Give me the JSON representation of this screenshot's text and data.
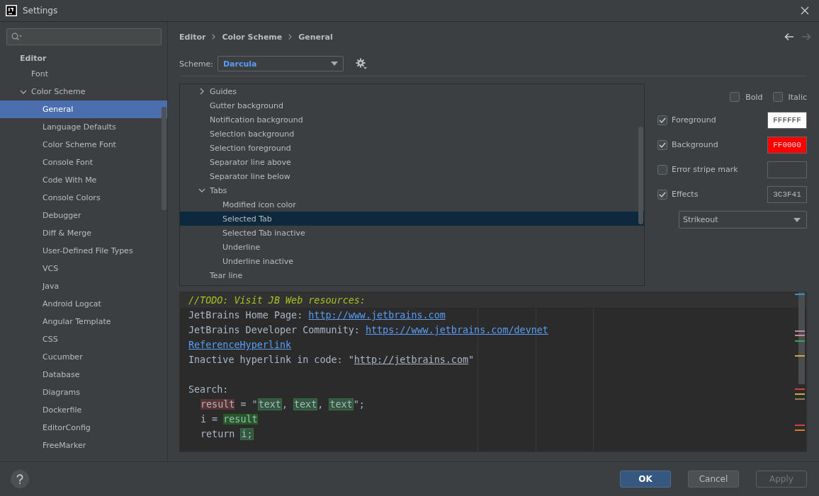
{
  "window": {
    "title": "Settings"
  },
  "sidebar": {
    "items": [
      {
        "label": "Editor",
        "kind": "header",
        "children": [
          {
            "label": "Font",
            "selected": false
          },
          {
            "label": "Color Scheme",
            "selected": false,
            "expanded": true,
            "children": [
              {
                "label": "General",
                "selected": true
              },
              {
                "label": "Language Defaults",
                "selected": false
              },
              {
                "label": "Color Scheme Font",
                "selected": false
              },
              {
                "label": "Console Font",
                "selected": false
              },
              {
                "label": "Code With Me",
                "selected": false
              },
              {
                "label": "Console Colors",
                "selected": false
              },
              {
                "label": "Debugger",
                "selected": false
              },
              {
                "label": "Diff & Merge",
                "selected": false
              },
              {
                "label": "User-Defined File Types",
                "selected": false
              },
              {
                "label": "VCS",
                "selected": false
              },
              {
                "label": "Java",
                "selected": false
              },
              {
                "label": "Android Logcat",
                "selected": false
              },
              {
                "label": "Angular Template",
                "selected": false
              },
              {
                "label": "CSS",
                "selected": false
              },
              {
                "label": "Cucumber",
                "selected": false
              },
              {
                "label": "Database",
                "selected": false
              },
              {
                "label": "Diagrams",
                "selected": false
              },
              {
                "label": "Dockerfile",
                "selected": false
              },
              {
                "label": "EditorConfig",
                "selected": false
              },
              {
                "label": "FreeMarker",
                "selected": false
              }
            ]
          }
        ]
      }
    ]
  },
  "breadcrumb": [
    "Editor",
    "Color Scheme",
    "General"
  ],
  "navigation": {
    "back_disabled": false,
    "forward_disabled": true
  },
  "scheme": {
    "label": "Scheme:",
    "value": "Darcula"
  },
  "elements": [
    {
      "label": "Guides",
      "selected": false,
      "expanded": false
    },
    {
      "label": "Gutter background",
      "selected": false
    },
    {
      "label": "Notification background",
      "selected": false
    },
    {
      "label": "Selection background",
      "selected": false
    },
    {
      "label": "Selection foreground",
      "selected": false
    },
    {
      "label": "Separator line above",
      "selected": false
    },
    {
      "label": "Separator line below",
      "selected": false
    },
    {
      "label": "Tabs",
      "selected": false,
      "expanded": true,
      "children": [
        {
          "label": "Modified icon color",
          "selected": false
        },
        {
          "label": "Selected Tab",
          "selected": true
        },
        {
          "label": "Selected Tab inactive",
          "selected": false
        },
        {
          "label": "Underline",
          "selected": false
        },
        {
          "label": "Underline inactive",
          "selected": false
        }
      ]
    },
    {
      "label": "Tear line",
      "selected": false
    }
  ],
  "font_style": [
    {
      "label": "Bold",
      "checked": false
    },
    {
      "label": "Italic",
      "checked": false
    }
  ],
  "attributes": [
    {
      "label": "Foreground",
      "checked": true,
      "value": "FFFFFF",
      "color": "#ffffff"
    },
    {
      "label": "Background",
      "checked": true,
      "value": "FF0000",
      "color": "#ff0000"
    },
    {
      "label": "Error stripe mark",
      "checked": false
    },
    {
      "label": "Effects",
      "checked": true,
      "value": "3C3F41",
      "color": "#3c3f41"
    }
  ],
  "effect_type": "Strikeout",
  "preview": {
    "lines": [
      {
        "kind": "code",
        "current": true,
        "segments": [
          {
            "text": "//TODO: Visit JB Web resources:",
            "kind": "comment"
          }
        ]
      },
      {
        "kind": "code",
        "segments": [
          {
            "text": "JetBrains Home Page: ",
            "kind": "plain"
          },
          {
            "text": "http://www.jetbrains.com",
            "kind": "link"
          }
        ]
      },
      {
        "kind": "code",
        "segments": [
          {
            "text": "JetBrains Developer Community: ",
            "kind": "plain"
          },
          {
            "text": "https://www.jetbrains.com/devnet",
            "kind": "link"
          }
        ]
      },
      {
        "kind": "code",
        "segments": [
          {
            "text": "ReferenceHyperlink",
            "kind": "link"
          }
        ]
      },
      {
        "kind": "code",
        "segments": [
          {
            "text": "Inactive hyperlink in code: \"",
            "kind": "plain"
          },
          {
            "text": "http://jetbrains.com",
            "kind": "inactive-link"
          },
          {
            "text": "\"",
            "kind": "plain"
          }
        ]
      },
      {
        "kind": "blank"
      },
      {
        "kind": "code",
        "segments": [
          {
            "text": "Search:",
            "kind": "plain"
          }
        ]
      },
      {
        "kind": "code",
        "indented": true,
        "segments": [
          {
            "text": "result",
            "kind": "write-usage"
          },
          {
            "text": " = \"",
            "kind": "plain"
          },
          {
            "text": "text",
            "kind": "match"
          },
          {
            "text": ", ",
            "kind": "plain"
          },
          {
            "text": "text",
            "kind": "match"
          },
          {
            "text": ", ",
            "kind": "plain"
          },
          {
            "text": "text",
            "kind": "match"
          },
          {
            "text": "\";",
            "kind": "plain"
          }
        ]
      },
      {
        "kind": "code",
        "indented": true,
        "segments": [
          {
            "text": "i = ",
            "kind": "plain"
          },
          {
            "text": "result",
            "kind": "read-usage"
          }
        ]
      },
      {
        "kind": "code",
        "indented": true,
        "segments": [
          {
            "text": "return ",
            "kind": "plain"
          },
          {
            "text": "i;",
            "kind": "match"
          }
        ]
      }
    ]
  },
  "buttons": [
    {
      "label": "OK",
      "kind": "default",
      "disabled": false
    },
    {
      "label": "Cancel",
      "kind": "normal",
      "disabled": false
    },
    {
      "label": "Apply",
      "kind": "normal",
      "disabled": true
    }
  ]
}
